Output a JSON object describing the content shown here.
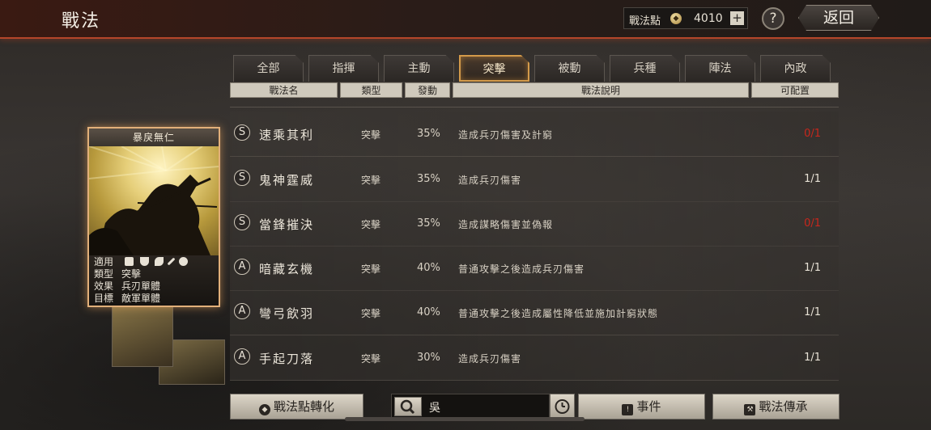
{
  "header": {
    "title": "戰法",
    "points_label": "戰法點",
    "points_value": "4010",
    "plus_label": "+",
    "help_label": "?",
    "back_label": "返回"
  },
  "tabs": [
    {
      "label": "全部",
      "active": false
    },
    {
      "label": "指揮",
      "active": false
    },
    {
      "label": "主動",
      "active": false
    },
    {
      "label": "突擊",
      "active": true
    },
    {
      "label": "被動",
      "active": false
    },
    {
      "label": "兵種",
      "active": false
    },
    {
      "label": "陣法",
      "active": false
    },
    {
      "label": "內政",
      "active": false
    }
  ],
  "columns": {
    "name": "戰法名",
    "type": "類型",
    "rate": "發動",
    "desc": "戰法說明",
    "available": "可配置"
  },
  "skills": [
    {
      "grade": "S",
      "name": "速乘其利",
      "type": "突擊",
      "rate": "35%",
      "desc": "造成兵刃傷害及計窮",
      "available": "0/1",
      "full": true
    },
    {
      "grade": "S",
      "name": "鬼神霆威",
      "type": "突擊",
      "rate": "35%",
      "desc": "造成兵刃傷害",
      "available": "1/1",
      "full": false
    },
    {
      "grade": "S",
      "name": "當鋒摧決",
      "type": "突擊",
      "rate": "35%",
      "desc": "造成謀略傷害並偽報",
      "available": "0/1",
      "full": true
    },
    {
      "grade": "A",
      "name": "暗藏玄機",
      "type": "突擊",
      "rate": "40%",
      "desc": "普通攻擊之後造成兵刃傷害",
      "available": "1/1",
      "full": false
    },
    {
      "grade": "A",
      "name": "彎弓飲羽",
      "type": "突擊",
      "rate": "40%",
      "desc": "普通攻擊之後造成屬性降低並施加計窮狀態",
      "available": "1/1",
      "full": false
    },
    {
      "grade": "A",
      "name": "手起刀落",
      "type": "突擊",
      "rate": "30%",
      "desc": "造成兵刃傷害",
      "available": "1/1",
      "full": false
    }
  ],
  "card": {
    "title": "暴戾無仁",
    "applies_label": "適用",
    "type_label": "類型",
    "type_value": "突擊",
    "effect_label": "效果",
    "effect_value": "兵刃單體",
    "target_label": "目標",
    "target_value": "敵軍單體",
    "unit_icons": [
      "cavalry-icon",
      "shield-icon",
      "bow-icon",
      "spear-icon",
      "wheel-icon"
    ]
  },
  "footer": {
    "convert_label": "戰法點轉化",
    "search_value": "吳",
    "event_label": "事件",
    "inherit_label": "戰法傳承"
  },
  "colors": {
    "accent_orange": "#d39a4a",
    "full_red": "#c8261c"
  }
}
